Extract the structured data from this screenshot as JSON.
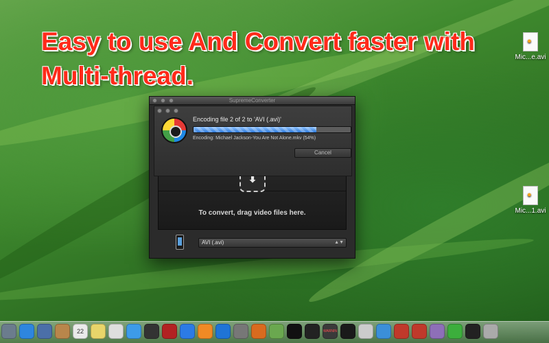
{
  "headline": "Easy to use And Convert faster with Multi-thread.",
  "desktop": {
    "files": [
      {
        "label": "Mic...e.avi"
      },
      {
        "label": "Mic...1.avi"
      }
    ]
  },
  "window": {
    "title": "SupremeConverter",
    "sheet": {
      "status_title": "Encoding file 2 of 2 to 'AVI (.avi)'",
      "status_detail": "Encoding: Michael Jackson-You Are Not Alone.mkv (54%)",
      "progress_fraction": 0.78,
      "cancel_label": "Cancel"
    },
    "drop_text": "To convert, drag video files here.",
    "format_selected": "AVI (.avi)"
  },
  "dock": {
    "items": [
      {
        "icon": "finder-icon",
        "color": "#6b7c8d"
      },
      {
        "icon": "safari-icon",
        "color": "#2e86de"
      },
      {
        "icon": "preview-icon",
        "color": "#4b6fa8"
      },
      {
        "icon": "contacts-icon",
        "color": "#b8864b"
      },
      {
        "icon": "calendar-icon",
        "color": "#eaeaea",
        "text": "22"
      },
      {
        "icon": "notes-icon",
        "color": "#e8d56a"
      },
      {
        "icon": "textedit-icon",
        "color": "#dedede"
      },
      {
        "icon": "messages-icon",
        "color": "#3d9be9"
      },
      {
        "icon": "camera-icon",
        "color": "#333333"
      },
      {
        "icon": "photo-booth-icon",
        "color": "#b22222"
      },
      {
        "icon": "itunes-icon",
        "color": "#2c7be5"
      },
      {
        "icon": "ibooks-icon",
        "color": "#f08a24"
      },
      {
        "icon": "app-store-icon",
        "color": "#1f74d6"
      },
      {
        "icon": "system-preferences-icon",
        "color": "#777777"
      },
      {
        "icon": "matlab-icon",
        "color": "#d96b1f"
      },
      {
        "icon": "brackets-icon",
        "color": "#6aa84f"
      },
      {
        "icon": "terminal-icon",
        "color": "#111111"
      },
      {
        "icon": "activity-monitor-icon",
        "color": "#222222"
      },
      {
        "icon": "console-icon",
        "color": "#3a3a3a",
        "text": "WARNIN"
      },
      {
        "icon": "terminal-2-icon",
        "color": "#1a1a1a"
      },
      {
        "icon": "quicktime-icon",
        "color": "#cccccc"
      },
      {
        "icon": "xcode-icon",
        "color": "#3b8fd9"
      },
      {
        "icon": "qq-icon",
        "color": "#c0392b"
      },
      {
        "icon": "qq-2-icon",
        "color": "#c0392b"
      },
      {
        "icon": "photos-icon",
        "color": "#8e6fb8"
      },
      {
        "icon": "wechat-icon",
        "color": "#3cae3c"
      },
      {
        "icon": "supremeconverter-icon",
        "color": "#222222"
      },
      {
        "icon": "trash-icon",
        "color": "#aaaaaa"
      }
    ]
  }
}
